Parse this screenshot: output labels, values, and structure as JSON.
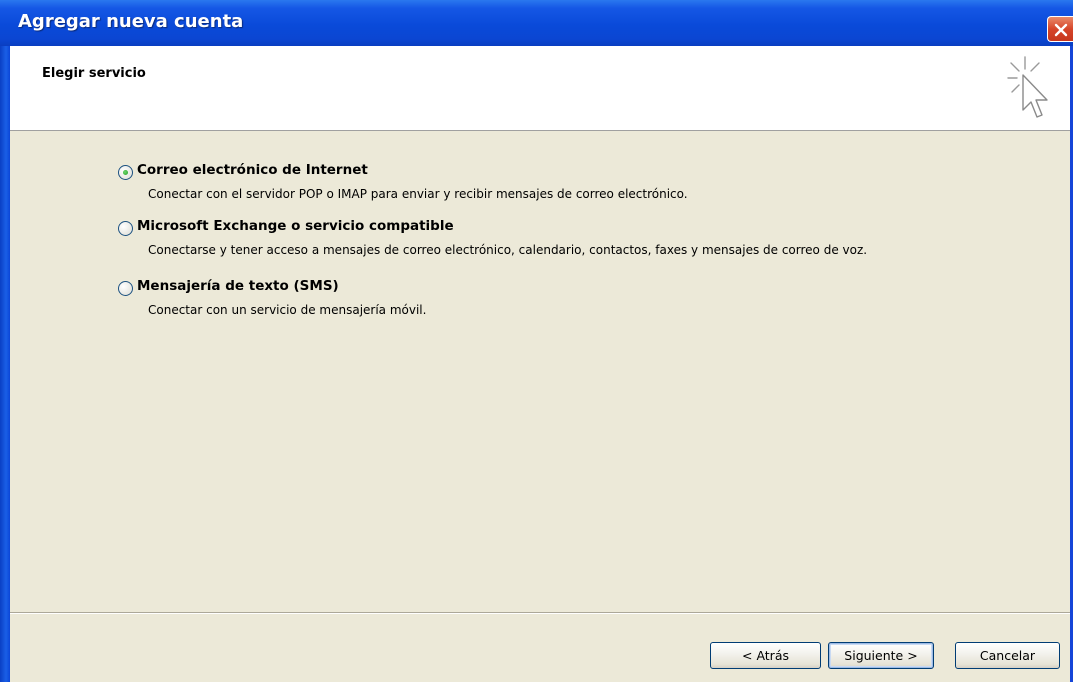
{
  "window": {
    "title": "Agregar nueva cuenta"
  },
  "header": {
    "title": "Elegir servicio",
    "icon": "wizard-cursor-icon"
  },
  "options": [
    {
      "label": "Correo electrónico de Internet",
      "description": "Conectar con el servidor POP o IMAP para enviar y recibir mensajes de correo electrónico.",
      "selected": true
    },
    {
      "label": "Microsoft Exchange o servicio compatible",
      "description": "Conectarse y tener acceso a mensajes de correo electrónico, calendario, contactos, faxes y mensajes de correo de voz.",
      "selected": false
    },
    {
      "label": "Mensajería de texto (SMS)",
      "description": "Conectar con un servicio de mensajería móvil.",
      "selected": false
    }
  ],
  "buttons": {
    "back": "< Atrás",
    "next": "Siguiente >",
    "cancel": "Cancelar"
  },
  "colors": {
    "titlebar": "#0a4ad9",
    "panel": "#ece9d8",
    "close": "#d6452a",
    "radio_selected": "#21a121"
  }
}
